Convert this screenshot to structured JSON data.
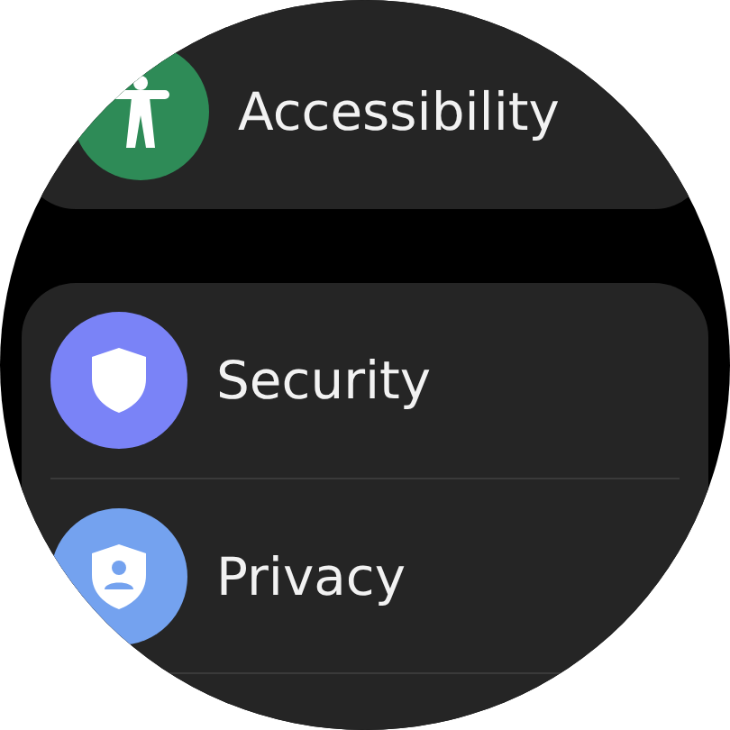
{
  "groups": [
    {
      "items": [
        {
          "label": "Accessibility",
          "kind": "accessibility",
          "color": "#2e8b57"
        }
      ]
    },
    {
      "items": [
        {
          "label": "Security",
          "kind": "security",
          "color": "#7a83f7"
        },
        {
          "label": "Privacy",
          "kind": "privacy",
          "color": "#74a2ef"
        }
      ]
    }
  ]
}
